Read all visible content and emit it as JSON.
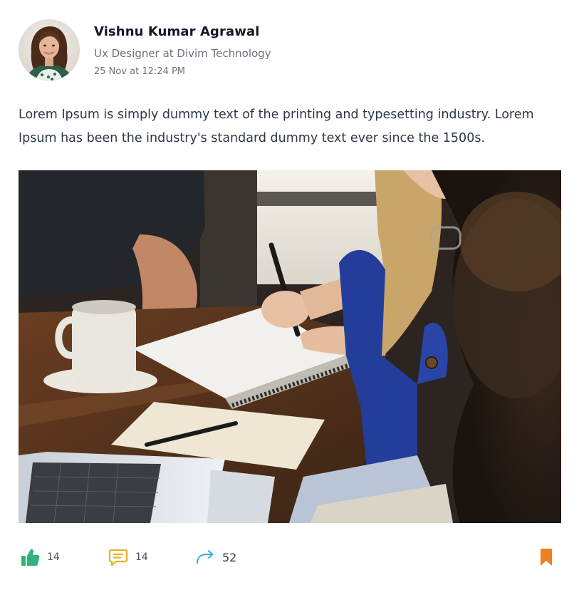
{
  "post": {
    "author": {
      "name": "Vishnu Kumar Agrawal",
      "title": "Ux Designer at Divim Technology",
      "timestamp": "25 Nov at 12:24 PM",
      "avatar_icon": "profile-photo"
    },
    "body": "Lorem Ipsum is simply dummy text of the printing and typesetting industry. Lorem Ipsum has been the industry's standard dummy text ever since the 1500s.",
    "image_description_icon": "team-meeting-photo",
    "actions": {
      "likes": "14",
      "comments": "14",
      "shares": "52",
      "like_icon": "thumbs-up-icon",
      "comment_icon": "comment-icon",
      "share_icon": "share-arrow-icon",
      "bookmark_icon": "bookmark-icon"
    },
    "colors": {
      "like": "#2fb37a",
      "comment": "#e8b022",
      "share": "#2bb0d9",
      "bookmark": "#f07f1f"
    }
  }
}
